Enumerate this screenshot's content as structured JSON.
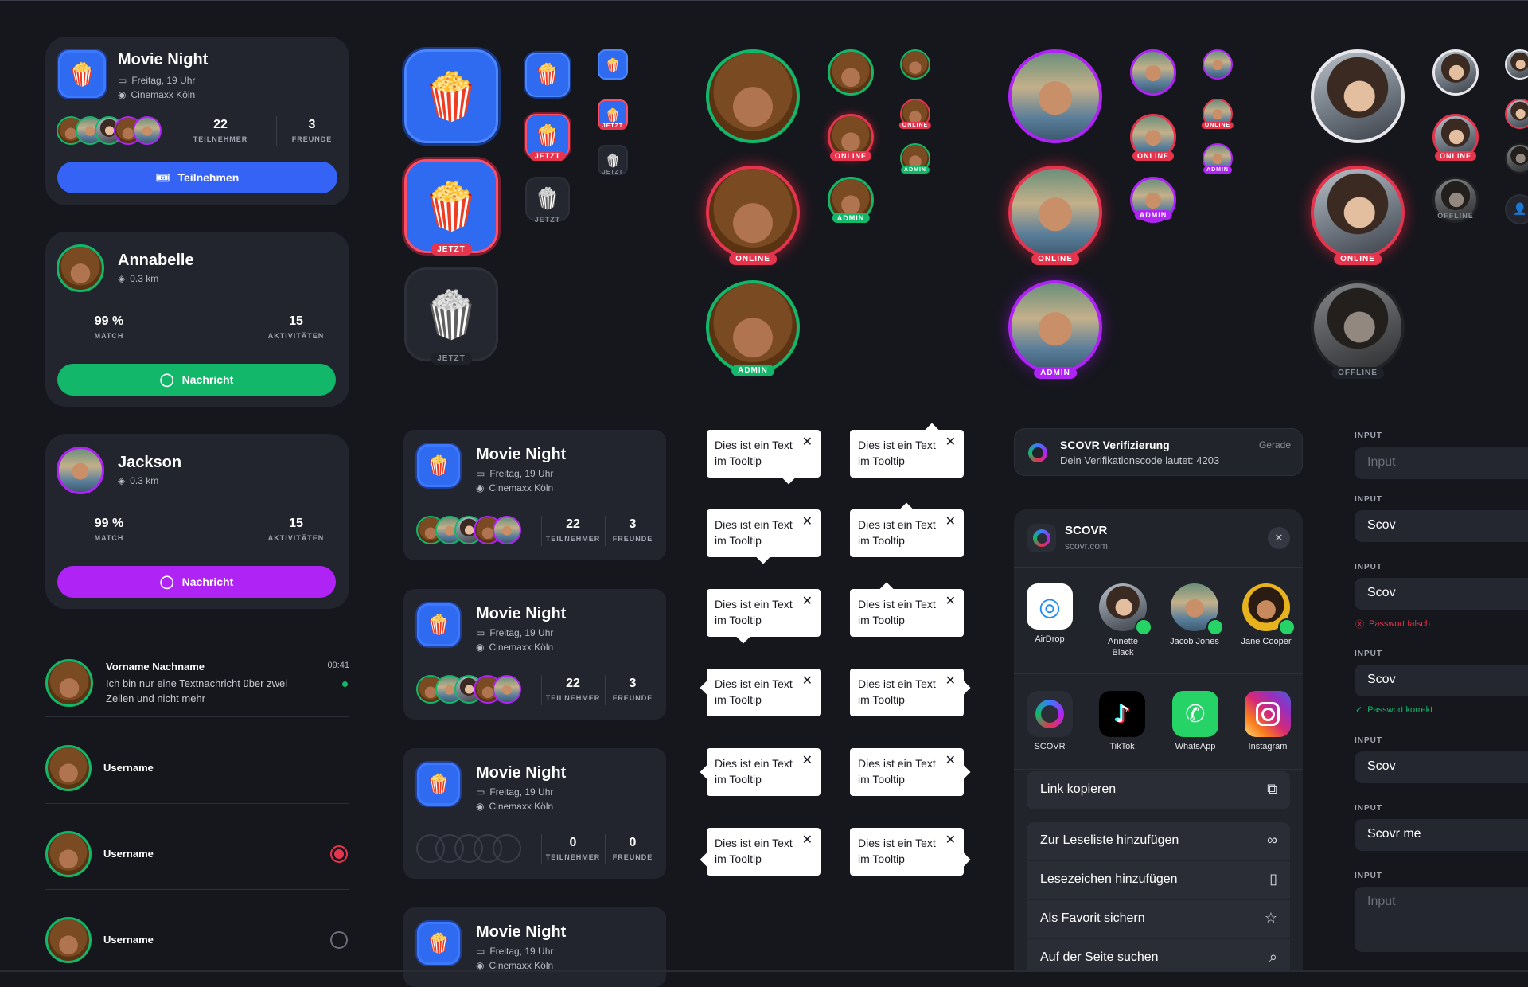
{
  "event": {
    "title": "Movie Night",
    "date": "Freitag, 19 Uhr",
    "place": "Cinemaxx Köln",
    "participants": "22",
    "participants_label": "TEILNEHMER",
    "friends": "3",
    "friends_label": "FREUNDE",
    "cta": "Teilnehmen",
    "empty_count": "0"
  },
  "profiles": [
    {
      "name": "Annabelle",
      "distance": "0.3 km",
      "match": "99 %",
      "match_label": "MATCH",
      "activities": "15",
      "activities_label": "AKTIVITÄTEN",
      "cta": "Nachricht"
    },
    {
      "name": "Jackson",
      "distance": "0.3 km",
      "match": "99 %",
      "match_label": "MATCH",
      "activities": "15",
      "activities_label": "AKTIVITÄTEN",
      "cta": "Nachricht"
    }
  ],
  "chat_item": {
    "name": "Vorname Nachname",
    "text_line1": "Ich bin nur eine Textnachricht über zwei",
    "text_line2": "Zeilen und nicht mehr",
    "time": "09:41"
  },
  "user_rows": [
    "Username",
    "Username",
    "Username"
  ],
  "badges": {
    "now": "JETZT",
    "online": "ONLINE",
    "admin": "ADMIN",
    "offline": "OFFLINE"
  },
  "tooltip": {
    "line1": "Dies ist ein Text",
    "line2": "im Tooltip",
    "close": "✕"
  },
  "notification": {
    "title": "SCOVR Verifizierung",
    "body": "Dein Verifikationscode lautet: 4203",
    "time": "Gerade"
  },
  "share": {
    "app": "SCOVR",
    "url": "scovr.com",
    "contacts": [
      {
        "name": "AirDrop"
      },
      {
        "name": "Annette",
        "name2": "Black"
      },
      {
        "name": "Jacob Jones"
      },
      {
        "name": "Jane Cooper"
      }
    ],
    "apps": [
      "SCOVR",
      "TikTok",
      "WhatsApp",
      "Instagram"
    ],
    "copy_link": "Link kopieren",
    "actions": [
      "Zur Leseliste hinzufügen",
      "Lesezeichen hinzufügen",
      "Als Favorit sichern",
      "Auf der Seite suchen"
    ]
  },
  "inputs": {
    "label": "INPUT",
    "placeholder": "Input",
    "typed": "Scov",
    "filled": "Scovr me",
    "error": "Passwort falsch",
    "success": "Passwort korrekt"
  },
  "colors": {
    "bg": "#16171d",
    "card": "#23252e",
    "blue": "#3563f5",
    "green": "#12b76a",
    "purple": "#b023f5",
    "red": "#e5344d"
  }
}
